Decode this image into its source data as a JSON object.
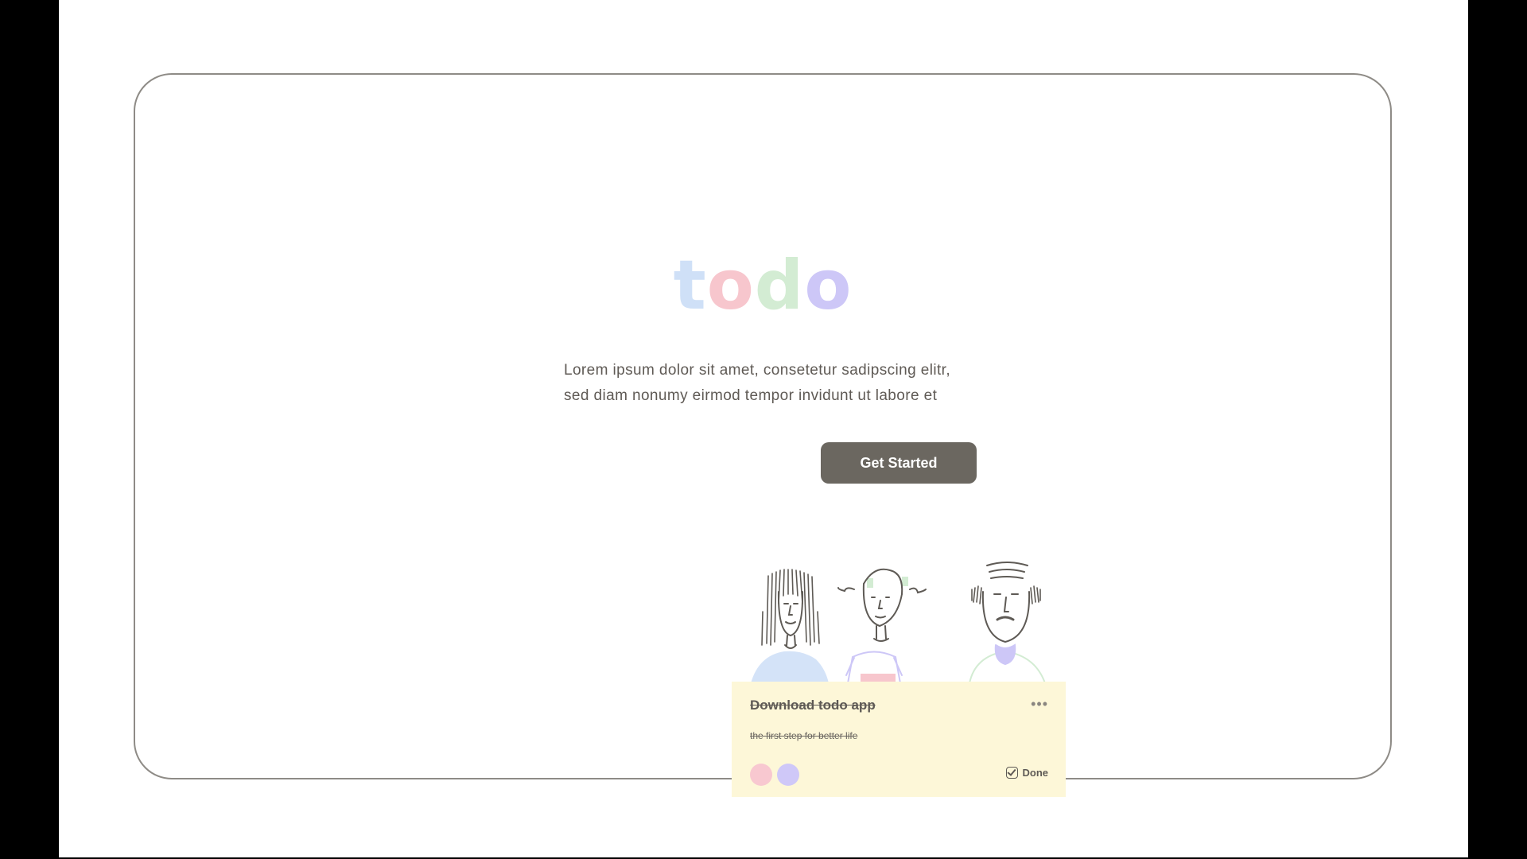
{
  "logo": {
    "letters": [
      "t",
      "o",
      "d",
      "o"
    ],
    "colors": [
      "#cfe0f7",
      "#f7c6cd",
      "#d3ecd3",
      "#cdc7f7"
    ]
  },
  "hero": {
    "tagline_line1": "Lorem ipsum dolor sit amet, consetetur sadipscing elitr,",
    "tagline_line2": "sed diam nonumy eirmod tempor invidunt ut labore et",
    "cta_label": "Get Started"
  },
  "illustration": {
    "icon": "three-people-illustration"
  },
  "todo_card": {
    "title": "Download todo app",
    "subtitle": "the first step for better life",
    "menu_icon": "more-horizontal-icon",
    "tags": [
      {
        "color": "#f8c8d0"
      },
      {
        "color": "#cfc8f8"
      }
    ],
    "status_label": "Done",
    "status_icon": "checkbox-checked-icon",
    "background": "#fdf7d8"
  },
  "colors": {
    "button": "#6b6760",
    "text": "#5f5a55",
    "frame_border": "#8e8b86"
  }
}
